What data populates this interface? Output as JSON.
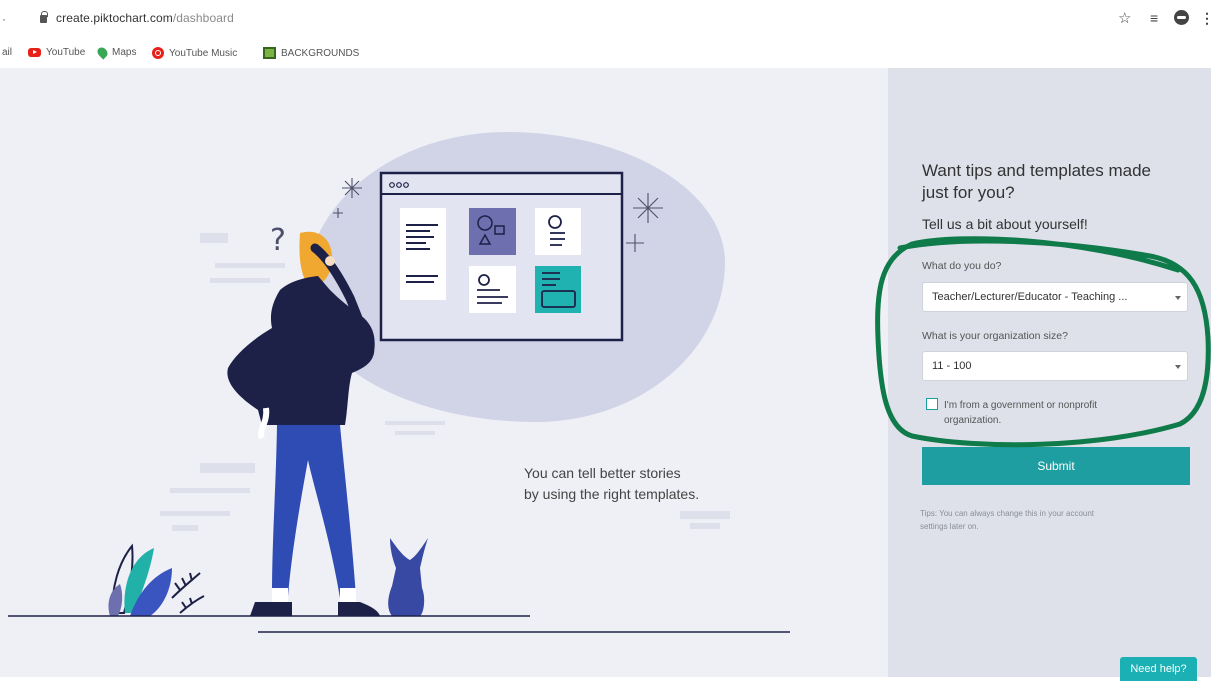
{
  "browser": {
    "url_host": "create.piktochart.com",
    "url_path": "/dashboard",
    "bookmarks": [
      {
        "label": "YouTube",
        "icon": "youtube-icon"
      },
      {
        "label": "Maps",
        "icon": "maps-icon"
      },
      {
        "label": "YouTube Music",
        "icon": "youtube-music-icon"
      },
      {
        "label": "BACKGROUNDS",
        "icon": "folder-icon"
      }
    ],
    "bookmark_fragment": "ail"
  },
  "main": {
    "tagline_line1": "You can tell better stories",
    "tagline_line2": "by using the right templates."
  },
  "form": {
    "title": "Want tips and templates made just for you?",
    "subtitle": "Tell us a bit about yourself!",
    "role_label": "What do you do?",
    "role_value": "Teacher/Lecturer/Educator - Teaching ...",
    "size_label": "What is your organization size?",
    "size_value": "11 - 100",
    "nonprofit_label": "I'm from a government or nonprofit organization.",
    "nonprofit_checked": false,
    "submit_label": "Submit",
    "tip": "Tips: You can always change this in your account settings later on."
  },
  "help_label": "Need help?",
  "colors": {
    "accent": "#1e9ea1",
    "annotation": "#0f7a4a",
    "illustration_navy": "#1d2147",
    "illustration_blue": "#2e4cb3",
    "illustration_yellow": "#f0a830"
  }
}
